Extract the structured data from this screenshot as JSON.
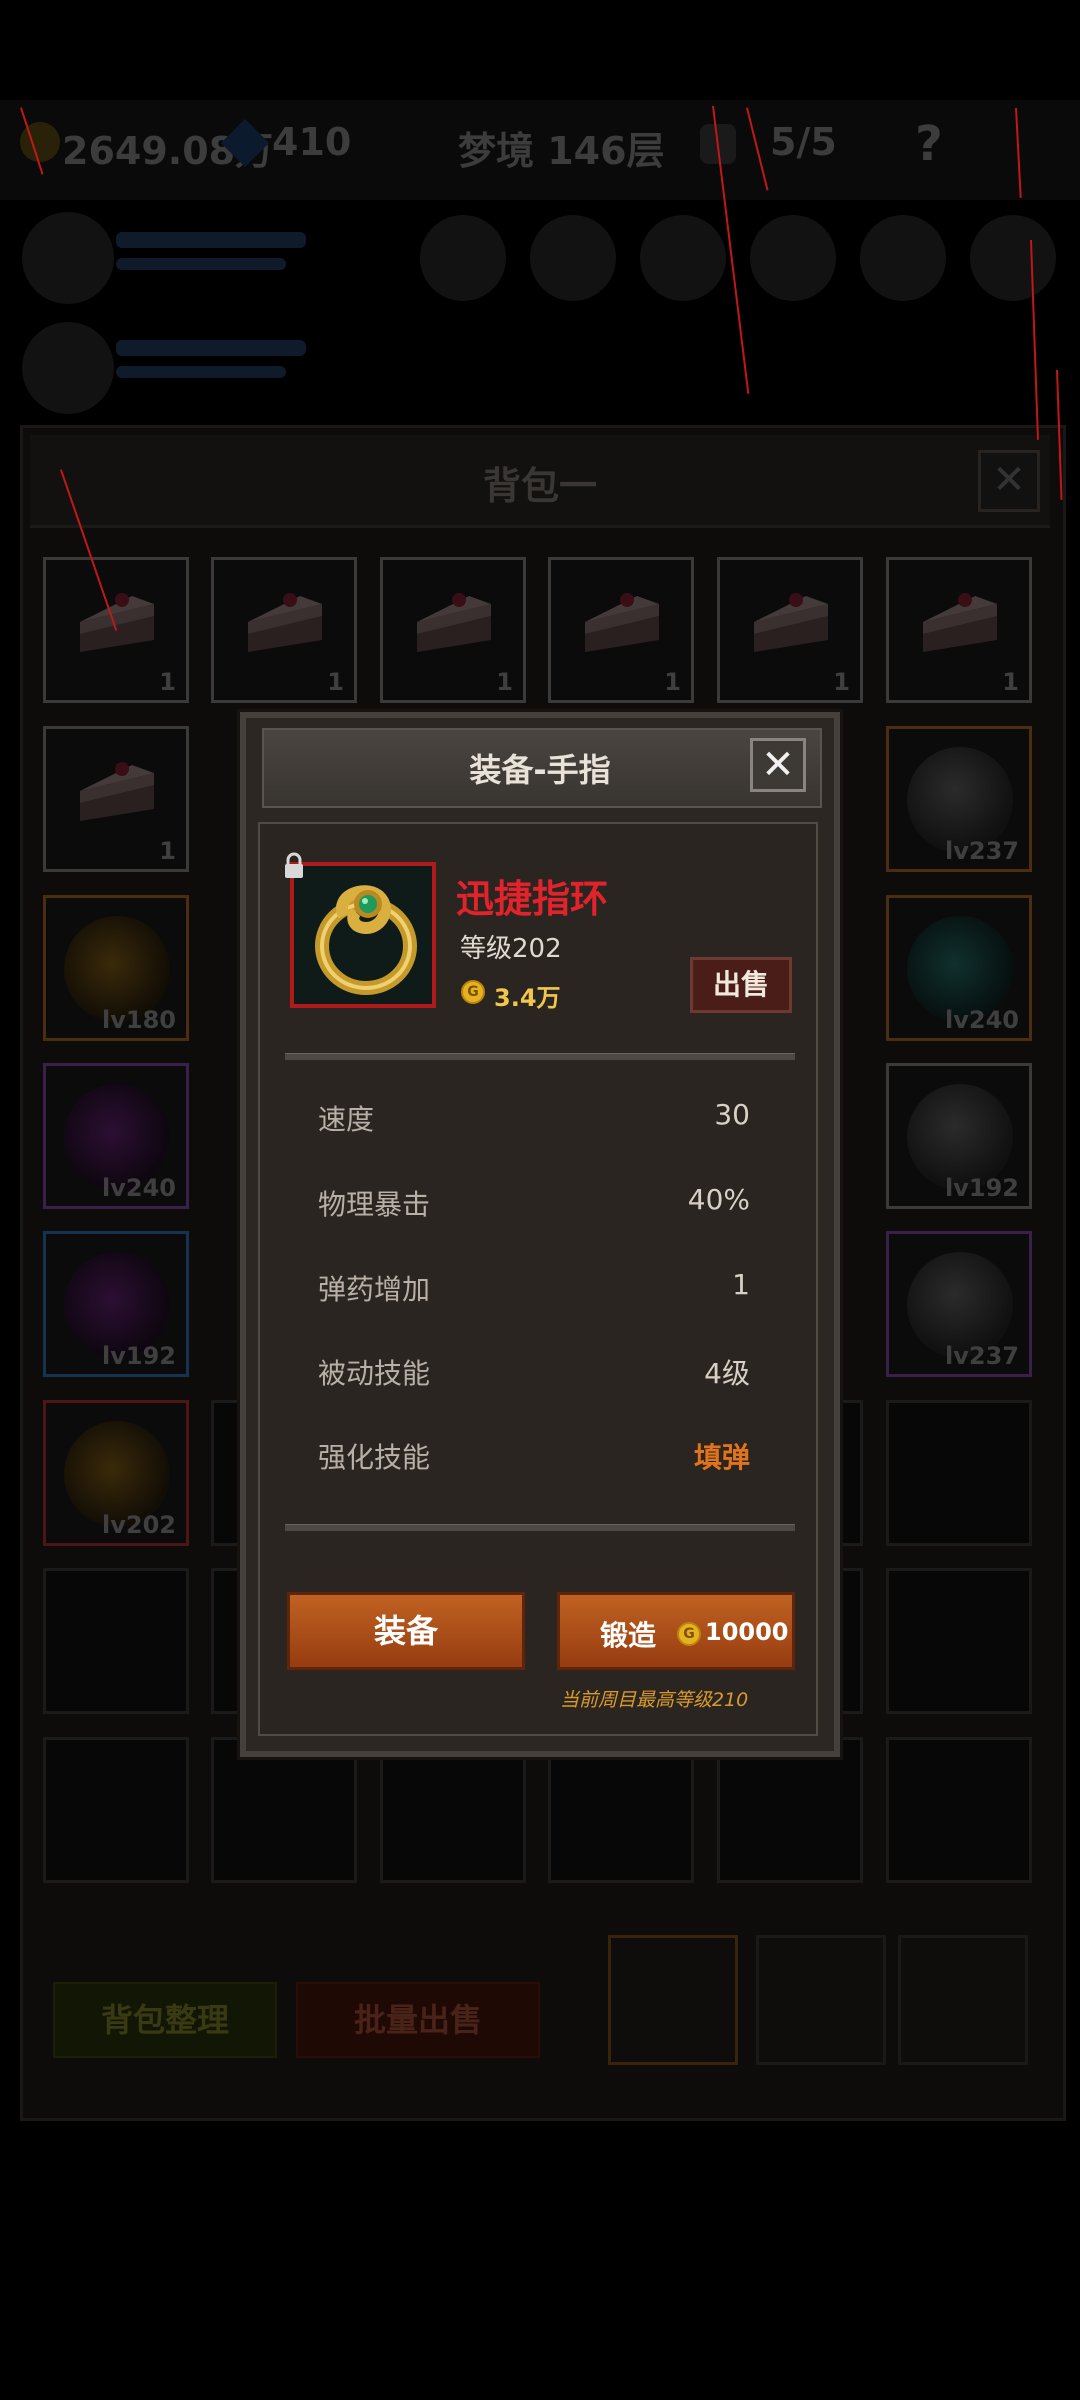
{
  "hud": {
    "gold": "2649.08万",
    "gems": "410",
    "stage": "梦境 146层",
    "keys": "5/5",
    "help": "?"
  },
  "bag": {
    "title": "背包一",
    "close": "✕",
    "sort_button": "背包整理",
    "bulk_sell_button": "批量出售",
    "cells": [
      {
        "kind": "cake",
        "label": "1",
        "rarity": "gray"
      },
      {
        "kind": "cake",
        "label": "1",
        "rarity": "gray"
      },
      {
        "kind": "cake",
        "label": "1",
        "rarity": "gray"
      },
      {
        "kind": "cake",
        "label": "1",
        "rarity": "gray"
      },
      {
        "kind": "cake",
        "label": "1",
        "rarity": "gray"
      },
      {
        "kind": "cake",
        "label": "1",
        "rarity": "gray"
      },
      {
        "kind": "cake",
        "label": "1",
        "rarity": "gray"
      },
      {
        "kind": "armor",
        "label": "lv237",
        "rarity": "orange"
      },
      {
        "kind": "amulet",
        "label": "lv180",
        "rarity": "orange"
      },
      {
        "kind": "orb",
        "label": "lv240",
        "rarity": "orange"
      },
      {
        "kind": "glove",
        "label": "lv240",
        "rarity": "purple"
      },
      {
        "kind": "armor",
        "label": "lv192",
        "rarity": "gray"
      },
      {
        "kind": "glove",
        "label": "lv192",
        "rarity": "blue"
      },
      {
        "kind": "armor",
        "label": "lv237",
        "rarity": "purple"
      },
      {
        "kind": "ring",
        "label": "lv202",
        "rarity": "red"
      }
    ]
  },
  "dialog": {
    "title": "装备-手指",
    "close": "✕",
    "item_name": "迅捷指环",
    "item_level": "等级202",
    "coin_symbol": "G",
    "item_price": "3.4万",
    "sell_button": "出售",
    "stats": [
      {
        "label": "速度",
        "value": "30"
      },
      {
        "label": "物理暴击",
        "value": "40%"
      },
      {
        "label": "弹药增加",
        "value": "1"
      },
      {
        "label": "被动技能",
        "value": "4级"
      },
      {
        "label": "强化技能",
        "value": "填弹"
      }
    ],
    "equip_button": "装备",
    "forge_button": "锻造",
    "forge_cost": "10000",
    "max_level_note": "当前周目最高等级210"
  },
  "colors": {
    "item_name": "#e2232b",
    "button_orange": "#b4521b",
    "highlight_orange": "#e0741c",
    "price_gold": "#f1c64b"
  }
}
